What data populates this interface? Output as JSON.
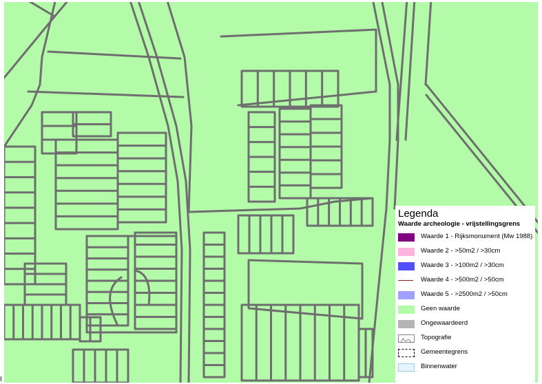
{
  "legend": {
    "title": "Legenda",
    "subtitle": "Waarde archeologie - vrijstellingsgrens",
    "items": [
      {
        "label": "Waarde 1 - Rijksmonument (Mw 1988)",
        "symbol": "fill",
        "color": "#800080"
      },
      {
        "label": "Waarde 2 - >50m2 / >30cm",
        "symbol": "fill",
        "color": "#ffb3dd"
      },
      {
        "label": "Waarde 3 - >100m2 / >30cm",
        "symbol": "fill",
        "color": "#5050ff"
      },
      {
        "label": "Waarde 4 - >500m2 / >50cm",
        "symbol": "line",
        "color": "#8b1a1a"
      },
      {
        "label": "Waarde 5 - >2500m2 / >50cm",
        "symbol": "fill",
        "color": "#a0a0ff"
      },
      {
        "label": "Geen waarde",
        "symbol": "fill",
        "color": "#b3fba8"
      },
      {
        "label": "Ongewaardeerd",
        "symbol": "fill",
        "color": "#b4b4b4"
      },
      {
        "label": "Topografie",
        "symbol": "topo",
        "color": "#808080"
      },
      {
        "label": "Gemeentegrens",
        "symbol": "dashed",
        "color": "#000000"
      },
      {
        "label": "Binnenwater",
        "symbol": "fill",
        "color": "#e6f5ff"
      }
    ]
  },
  "map": {
    "background_color": "#b3fba8",
    "parcel_line_color": "#6e6e6e"
  },
  "corner_mark": "I"
}
